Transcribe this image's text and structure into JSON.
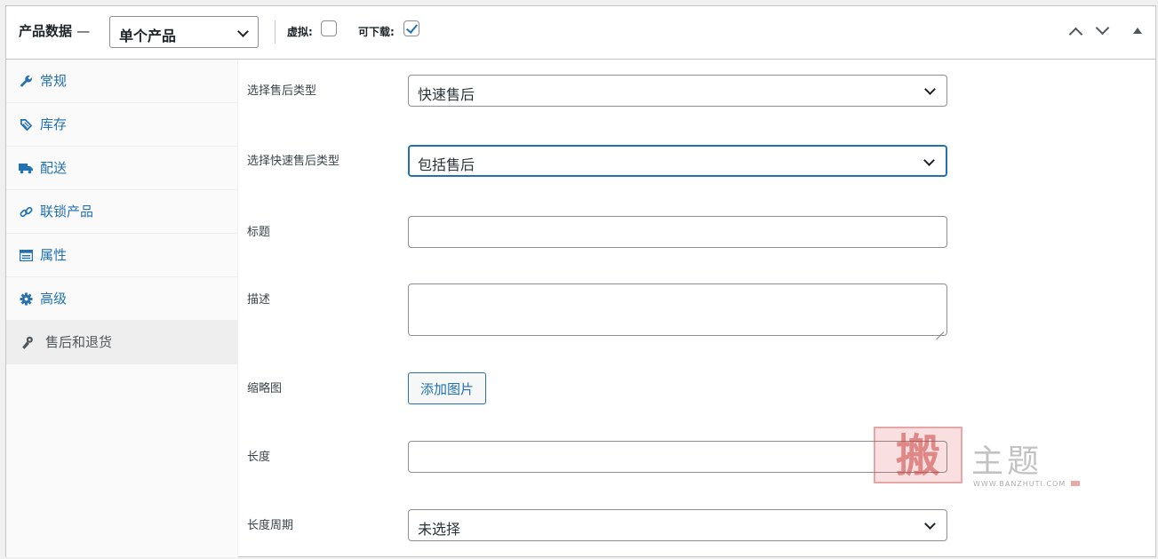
{
  "header": {
    "title": "产品数据",
    "dash": "—",
    "product_type": "单个产品",
    "virtual_label": "虚拟:",
    "virtual_checked": false,
    "downloadable_label": "可下载:",
    "downloadable_checked": true
  },
  "sidebar": {
    "items": [
      {
        "label": "常规",
        "icon": "wrench-icon"
      },
      {
        "label": "库存",
        "icon": "tag-icon"
      },
      {
        "label": "配送",
        "icon": "truck-icon"
      },
      {
        "label": "联锁产品",
        "icon": "link-icon"
      },
      {
        "label": "属性",
        "icon": "table-icon"
      },
      {
        "label": "高级",
        "icon": "gear-icon"
      },
      {
        "label": "售后和退货",
        "icon": "wrench-icon",
        "active": true
      }
    ]
  },
  "form": {
    "aftersale_type_label": "选择售后类型",
    "aftersale_type_value": "快速售后",
    "quick_type_label": "选择快速售后类型",
    "quick_type_value": "包括售后",
    "title_label": "标题",
    "title_value": "",
    "desc_label": "描述",
    "desc_value": "",
    "thumb_label": "缩略图",
    "add_image_button": "添加图片",
    "length_label": "长度",
    "length_value": "",
    "period_label": "长度周期",
    "period_value": "未选择"
  },
  "watermark": {
    "seal": "搬",
    "text": "主题",
    "url": "WWW.BANZHUTI.COM"
  },
  "colors": {
    "accent": "#2271b1",
    "border": "#8c8f94"
  }
}
